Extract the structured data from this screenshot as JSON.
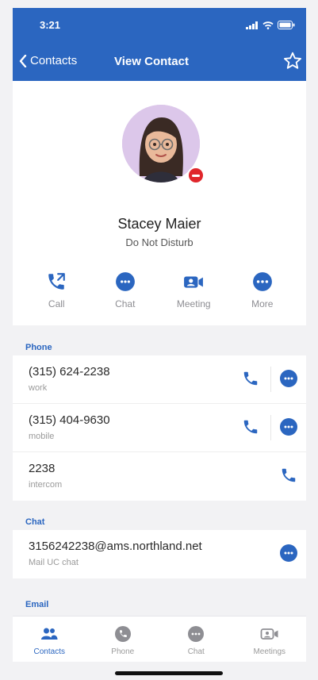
{
  "status_bar": {
    "time": "3:21"
  },
  "nav": {
    "back_label": "Contacts",
    "title": "View Contact"
  },
  "profile": {
    "name": "Stacey Maier",
    "status": "Do Not Disturb",
    "presence": "do-not-disturb"
  },
  "actions": [
    {
      "label": "Call",
      "icon": "phone-icon"
    },
    {
      "label": "Chat",
      "icon": "chat-icon"
    },
    {
      "label": "Meeting",
      "icon": "meeting-icon"
    },
    {
      "label": "More",
      "icon": "more-icon"
    }
  ],
  "sections": {
    "phone": {
      "label": "Phone",
      "rows": [
        {
          "value": "(315) 624-2238",
          "type": "work"
        },
        {
          "value": "(315) 404-9630",
          "type": "mobile"
        },
        {
          "value": "2238",
          "type": "intercom"
        }
      ]
    },
    "chat": {
      "label": "Chat",
      "rows": [
        {
          "value": "3156242238@ams.northland.net",
          "type": "Mail UC chat"
        }
      ]
    },
    "email": {
      "label": "Email"
    }
  },
  "tabs": [
    {
      "label": "Contacts",
      "icon": "contacts-icon",
      "active": true
    },
    {
      "label": "Phone",
      "icon": "phone-icon",
      "active": false
    },
    {
      "label": "Chat",
      "icon": "chat-icon",
      "active": false
    },
    {
      "label": "Meetings",
      "icon": "meeting-icon",
      "active": false
    }
  ],
  "colors": {
    "brand": "#2b66c0",
    "dnd": "#e0262b",
    "avatar_bg": "#dcc7ea"
  }
}
